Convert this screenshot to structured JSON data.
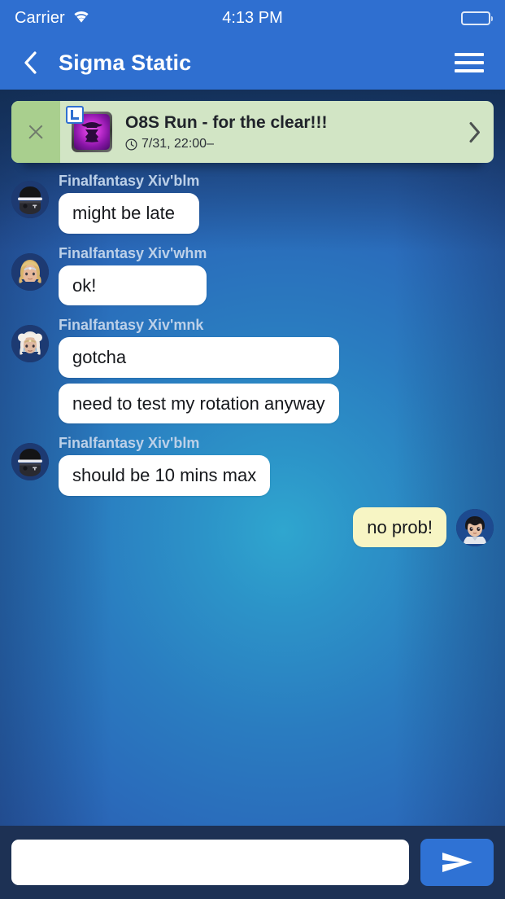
{
  "status_bar": {
    "carrier": "Carrier",
    "time": "4:13 PM",
    "wifi_icon": "wifi-icon",
    "battery_icon": "battery-full-icon"
  },
  "header": {
    "title": "Sigma Static",
    "back_icon": "chevron-left-icon",
    "menu_icon": "hamburger-menu-icon"
  },
  "event_banner": {
    "close_icon": "close-x-icon",
    "event_icon": "game-duty-icon",
    "badge_icon": "party-leader-badge-icon",
    "title": "O8S Run - for the clear!!!",
    "clock_icon": "clock-icon",
    "time": "7/31, 22:00–",
    "chevron_icon": "chevron-right-icon",
    "background_color": "#d2e5c5",
    "close_background_color": "#a9cf8e"
  },
  "chat": {
    "background_accent": "#2fa6cf",
    "groups": [
      {
        "side": "incoming",
        "sender": "Finalfantasy Xiv'blm",
        "avatar_name": "avatar-blm",
        "messages": [
          "might be late"
        ]
      },
      {
        "side": "incoming",
        "sender": "Finalfantasy Xiv'whm",
        "avatar_name": "avatar-whm",
        "messages": [
          "ok!"
        ]
      },
      {
        "side": "incoming",
        "sender": "Finalfantasy Xiv'mnk",
        "avatar_name": "avatar-mnk",
        "messages": [
          "gotcha",
          "need to test my rotation anyway"
        ]
      },
      {
        "side": "incoming",
        "sender": "Finalfantasy Xiv'blm",
        "avatar_name": "avatar-blm",
        "messages": [
          "should be 10 mins max"
        ]
      },
      {
        "side": "outgoing",
        "sender": "",
        "avatar_name": "avatar-self",
        "messages": [
          "no prob!"
        ],
        "bubble_color": "#f7f5c4"
      }
    ]
  },
  "composer": {
    "input_value": "",
    "input_placeholder": "",
    "send_icon": "send-paper-plane-icon",
    "send_button_color": "#2f72d4"
  }
}
